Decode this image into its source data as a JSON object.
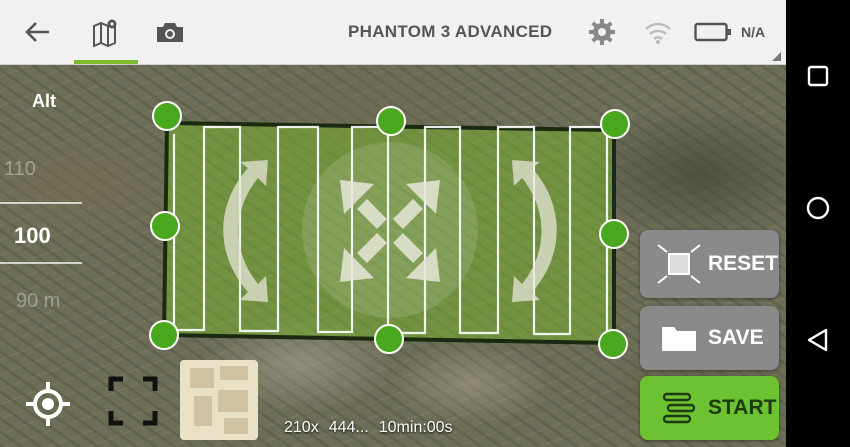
{
  "topbar": {
    "back_icon": "arrow-left-icon",
    "map_icon": "map-pin-icon",
    "camera_icon": "camera-icon",
    "title": "PHANTOM 3 ADVANCED",
    "settings_icon": "gear-icon",
    "signal_icon": "wifi-icon",
    "battery_icon": "battery-icon",
    "battery_value": "N/A",
    "active_tab_color": "#7dbb2b"
  },
  "altitude": {
    "label": "Alt",
    "faded_above": "110",
    "value": "100",
    "faded_below": "90 m"
  },
  "controls": {
    "reset_label": "RESET",
    "save_label": "SAVE",
    "start_label": "START",
    "start_color": "#6cc231"
  },
  "stats": {
    "photos": "210x",
    "distance": "444...",
    "duration": "10min:00s"
  },
  "navbar": {
    "recents_icon": "square-icon",
    "home_icon": "circle-icon",
    "back_icon": "triangle-back-icon"
  }
}
